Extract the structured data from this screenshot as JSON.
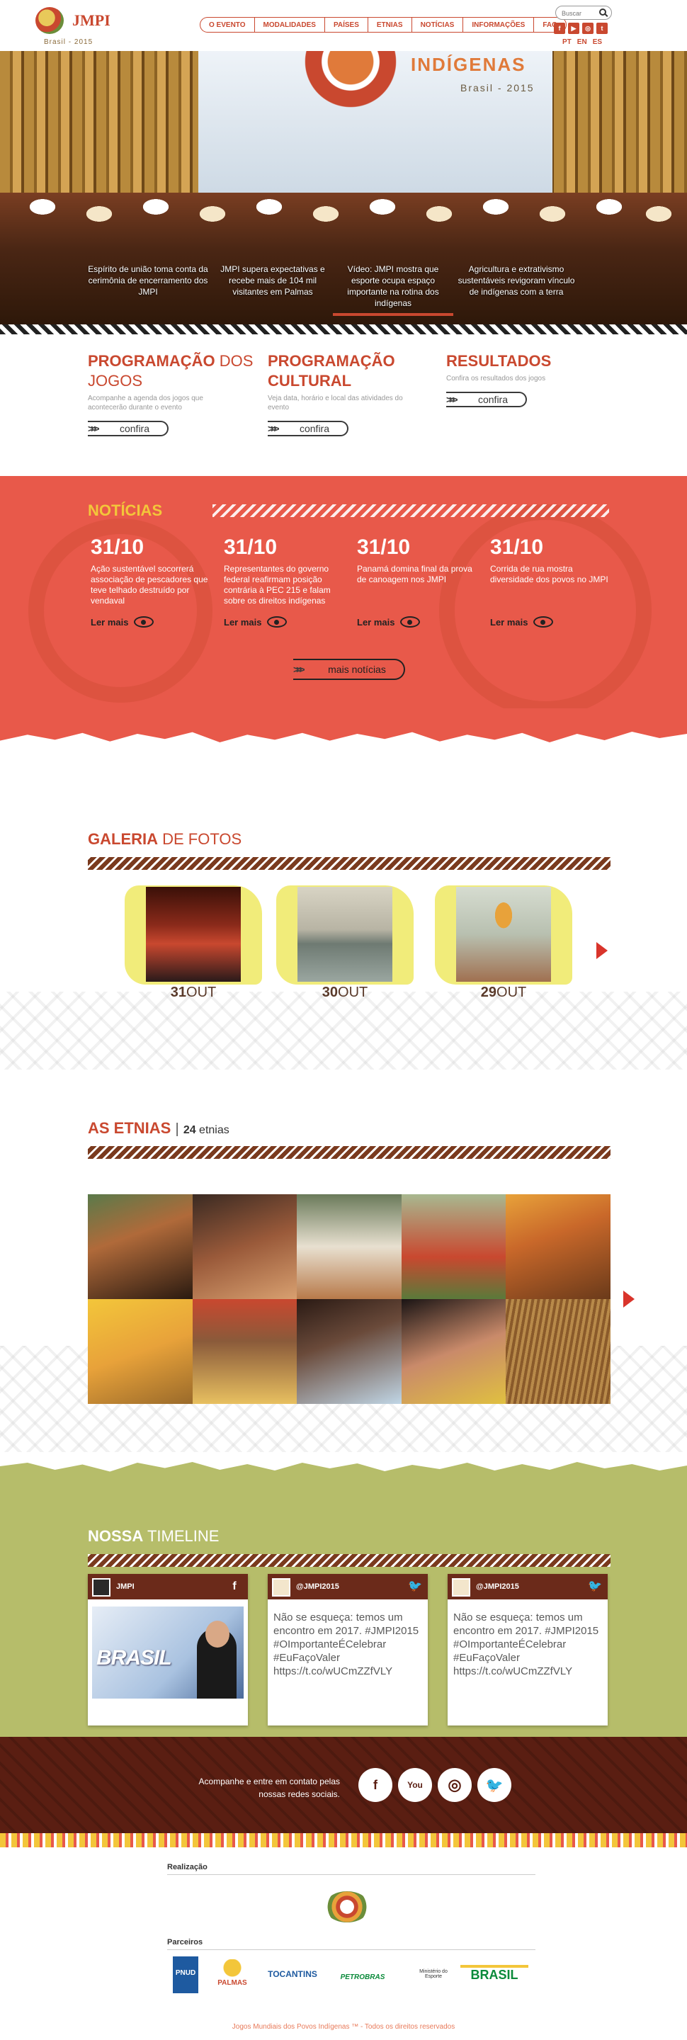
{
  "header": {
    "logo_text": "JMPI",
    "logo_sub": "Brasil - 2015",
    "nav": [
      "O EVENTO",
      "MODALIDADES",
      "PAÍSES",
      "ETNIAS",
      "NOTÍCIAS",
      "INFORMAÇÕES",
      "FAQ"
    ],
    "search_placeholder": "Buscar",
    "social_icons": [
      "facebook-icon",
      "youtube-icon",
      "instagram-icon",
      "twitter-icon"
    ],
    "languages": [
      "PT",
      "EN",
      "ES"
    ]
  },
  "hero": {
    "banner_title": "INDÍGENAS",
    "banner_sub": "Brasil - 2015",
    "captions": [
      "Espírito de união toma conta da cerimônia de encerramento dos JMPI",
      "JMPI supera expectativas e recebe mais de 104 mil visitantes em Palmas",
      "Vídeo: JMPI mostra que esporte ocupa espaço importante na rotina dos indígenas",
      "Agricultura e extrativismo sustentáveis revigoram vínculo de indígenas com a terra"
    ],
    "active_caption": 2
  },
  "programacao": [
    {
      "title_bold": "PROGRAMAÇÃO",
      "title_light": " DOS JOGOS",
      "desc": "Acompanhe a agenda dos jogos que acontecerão durante o evento",
      "button": "confira"
    },
    {
      "title_bold": "PROGRAMAÇÃO",
      "title_light": "",
      "title_line2": "CULTURAL",
      "desc": "Veja data, horário e local das atividades do evento",
      "button": "confira"
    },
    {
      "title_bold": "RESULTADOS",
      "title_light": "",
      "desc": "Confira os resultados dos jogos",
      "button": "confira"
    }
  ],
  "noticias": {
    "heading": "NOTÍCIAS",
    "items": [
      {
        "date": "31/10",
        "text": "Ação sustentável socorrerá associação de pescadores que teve telhado destruído por vendaval",
        "more": "Ler mais"
      },
      {
        "date": "31/10",
        "text": "Representantes do governo federal reafirmam posição contrária à PEC 215 e falam sobre os direitos indígenas",
        "more": "Ler mais"
      },
      {
        "date": "31/10",
        "text": "Panamá domina final da prova de canoagem nos JMPI",
        "more": "Ler mais"
      },
      {
        "date": "31/10",
        "text": "Corrida de rua mostra diversidade dos povos no JMPI",
        "more": "Ler mais"
      }
    ],
    "more_button": "mais notícias"
  },
  "galeria": {
    "title_bold": "GALERIA",
    "title_light": " DE FOTOS",
    "items": [
      {
        "day": "31",
        "month": "OUT"
      },
      {
        "day": "30",
        "month": "OUT"
      },
      {
        "day": "29",
        "month": "OUT"
      }
    ]
  },
  "etnias": {
    "title": "AS ETNIAS",
    "count_bold": "24",
    "count_label": " etnias"
  },
  "timeline": {
    "title_bold": "NOSSA",
    "title_light": " TIMELINE",
    "cards": [
      {
        "handle": "JMPI",
        "network": "facebook",
        "network_glyph": "f",
        "image_word": "BRASIL"
      },
      {
        "handle": "@JMPI2015",
        "network": "twitter",
        "network_glyph": "🐦",
        "text": "Não se esqueça: temos um encontro em 2017. #JMPI2015 #OImportanteÉCelebrar #EuFaçoValer https://t.co/wUCmZZfVLY"
      },
      {
        "handle": "@JMPI2015",
        "network": "twitter",
        "network_glyph": "🐦",
        "text": "Não se esqueça: temos um encontro em 2017. #JMPI2015 #OImportanteÉCelebrar #EuFaçoValer https://t.co/wUCmZZfVLY"
      }
    ]
  },
  "footer": {
    "social_text": "Acompanhe e entre em contato pelas nossas redes sociais.",
    "social_icons": [
      {
        "name": "facebook-icon",
        "glyph": "f"
      },
      {
        "name": "youtube-icon",
        "glyph": "You"
      },
      {
        "name": "instagram-icon",
        "glyph": "◎"
      },
      {
        "name": "twitter-icon",
        "glyph": "🐦"
      }
    ],
    "realizacao_label": "Realização",
    "parceiros_label": "Parceiros",
    "partners": [
      "PNUD",
      "PALMAS",
      "TOCANTINS",
      "PETROBRAS",
      "Ministério do Esporte",
      "BRASIL"
    ],
    "copyright": "Jogos Mundiais dos Povos Indígenas ™ - Todos os direitos reservados"
  },
  "colors": {
    "accent": "#c9482f",
    "news_bg": "#e8594a",
    "timeline_bg": "#b6bd6a",
    "footer_dark": "#5a1e12"
  }
}
